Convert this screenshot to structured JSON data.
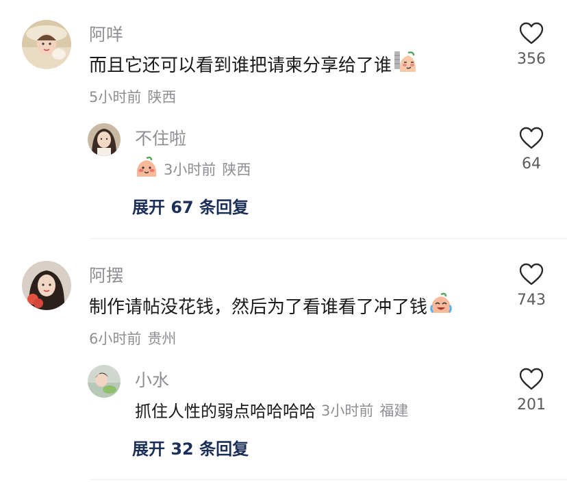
{
  "comments": [
    {
      "username": "阿咩",
      "text": "而且它还可以看到谁把请柬分享给了谁",
      "time": "5小时前",
      "location": "陕西",
      "likes": "356",
      "trailing_emoji": "smirk-peach-emoji",
      "reply": {
        "username": "不住啦",
        "leading_emoji": "blush-peach-emoji",
        "time": "3小时前",
        "location": "陕西",
        "likes": "64"
      },
      "expand_label": "展开 67 条回复"
    },
    {
      "username": "阿摆",
      "text": "制作请帖没花钱，然后为了看谁看了冲了钱",
      "time": "6小时前",
      "location": "贵州",
      "likes": "743",
      "trailing_emoji": "crying-laughing-peach-emoji",
      "reply": {
        "username": "小水",
        "text": "抓住人性的弱点哈哈哈哈",
        "time": "3小时前",
        "location": "福建",
        "likes": "201"
      },
      "expand_label": "展开 32 条回复"
    }
  ],
  "colors": {
    "username": "#8e8e93",
    "text": "#1a1a1a",
    "meta": "#8e8e93",
    "expand": "#1b2e57",
    "like_count": "#5a5a5f",
    "divider": "#ececec"
  }
}
